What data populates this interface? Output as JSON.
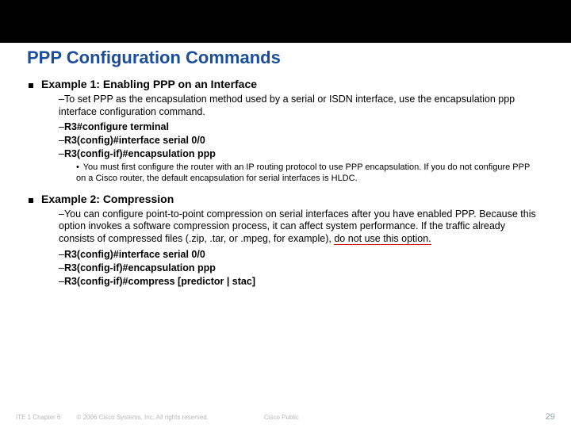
{
  "title": "PPP Configuration Commands",
  "example1": {
    "heading": "Example 1: Enabling PPP on an Interface",
    "intro": "–To set PPP as the encapsulation method used by a serial or ISDN interface, use the encapsulation ppp interface configuration command.",
    "cmd1": "R3#configure terminal",
    "cmd2": "R3(config)#interface serial 0/0",
    "cmd3": "R3(config-if)#encapsulation ppp",
    "note": "You must first configure the router with an IP routing protocol to use PPP encapsulation. If you do not configure PPP on a Cisco router, the default encapsulation for serial interfaces is HLDC."
  },
  "example2": {
    "heading": "Example 2: Compression",
    "intro_pre": "–You can configure point-to-point compression on serial interfaces after you have enabled PPP. Because this option invokes a software compression process, it can affect system performance. If the traffic already consists of compressed files (.zip, .tar, or .mpeg, for example), ",
    "intro_underlined": "do not use this option.",
    "cmd1": "R3(config)#interface serial 0/0",
    "cmd2": "R3(config-if)#encapsulation ppp",
    "cmd3": "R3(config-if)#compress [predictor | stac]"
  },
  "footer": {
    "left": "ITE 1 Chapter 6",
    "copy": "© 2006 Cisco Systems, Inc. All rights reserved.",
    "pub": "Cisco Public",
    "page": "29"
  }
}
